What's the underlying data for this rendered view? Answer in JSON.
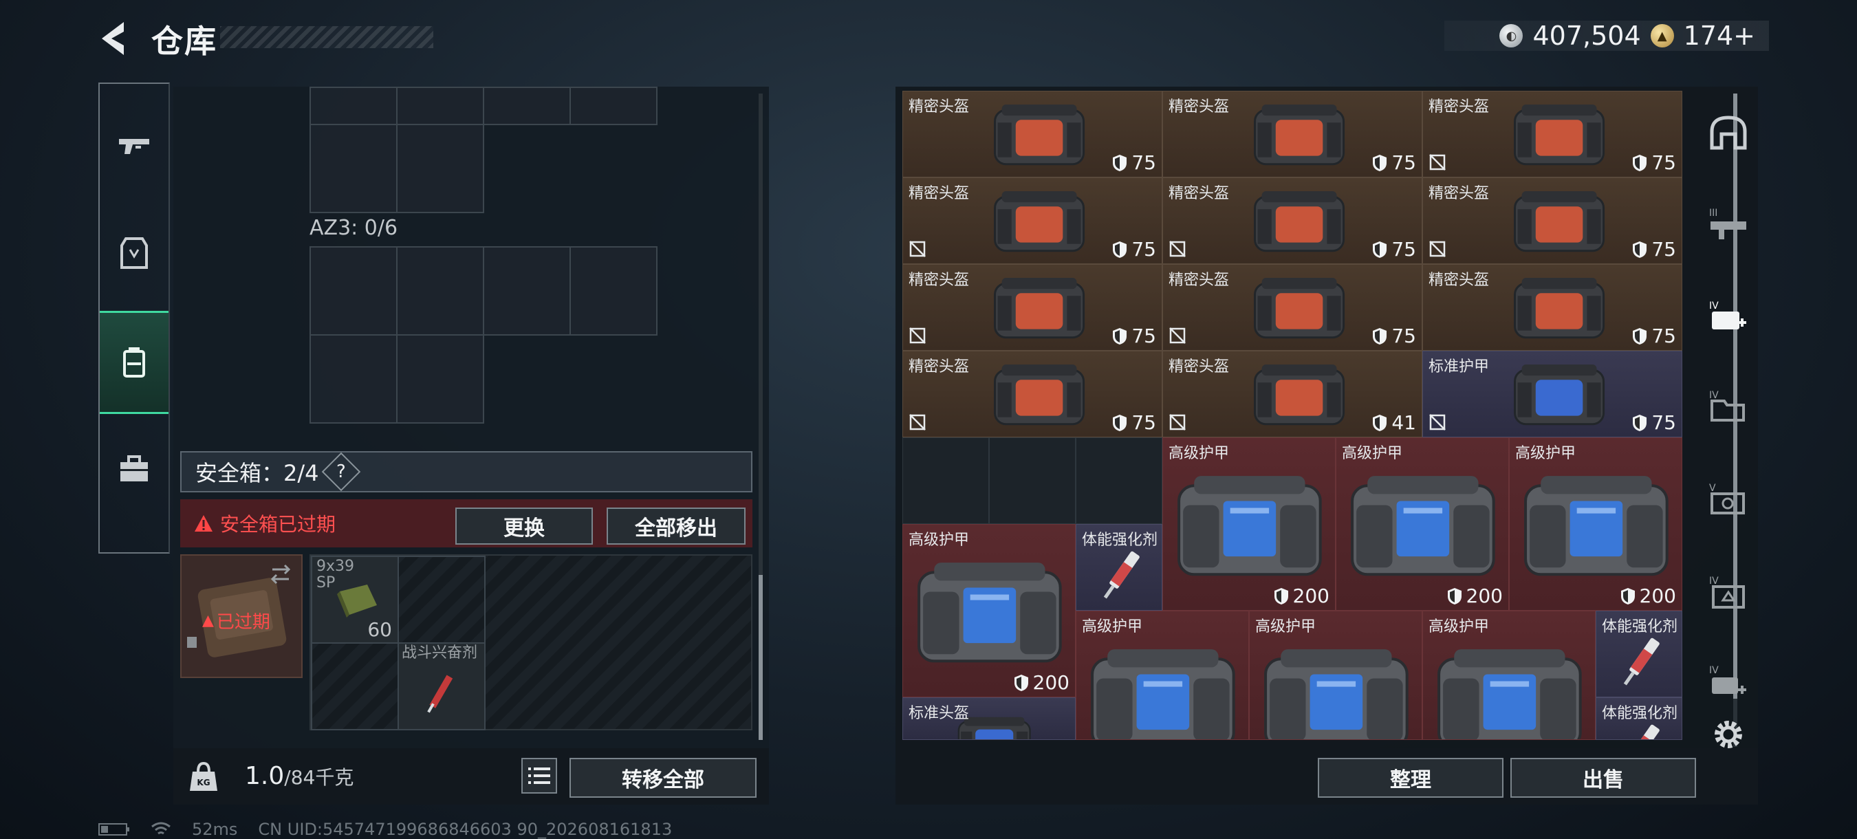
{
  "header": {
    "title": "仓库",
    "currency_silver": "407,504",
    "currency_gold": "174+"
  },
  "left": {
    "az_label": "AZ3: 0/6",
    "safebox_label": "安全箱：2/4",
    "help": "?",
    "expired_warning": "安全箱已过期",
    "replace_button": "更换",
    "move_all_out_button": "全部移出",
    "item_expired": "已过期",
    "ammo_label_line1": "9x39",
    "ammo_label_line2": "SP",
    "ammo_count": "60",
    "stim_label": "战斗兴奋剂",
    "weight_value": "1.0",
    "weight_max": "/84千克",
    "transfer_all_button": "转移全部",
    "weight_icon_label": "KG"
  },
  "right": {
    "sort_button": "整理",
    "sell_button": "出售",
    "items": [
      {
        "name": "精密头盔",
        "dur": "75",
        "kind": "helmet",
        "color": "brown",
        "noslot": false
      },
      {
        "name": "精密头盔",
        "dur": "75",
        "kind": "helmet",
        "color": "brown",
        "noslot": false
      },
      {
        "name": "精密头盔",
        "dur": "75",
        "kind": "helmet",
        "color": "brown",
        "noslot": true
      },
      {
        "name": "精密头盔",
        "dur": "75",
        "kind": "helmet",
        "color": "brown",
        "noslot": true
      },
      {
        "name": "精密头盔",
        "dur": "75",
        "kind": "helmet",
        "color": "brown",
        "noslot": true
      },
      {
        "name": "精密头盔",
        "dur": "75",
        "kind": "helmet",
        "color": "brown",
        "noslot": true
      },
      {
        "name": "精密头盔",
        "dur": "75",
        "kind": "helmet",
        "color": "brown",
        "noslot": true
      },
      {
        "name": "精密头盔",
        "dur": "75",
        "kind": "helmet",
        "color": "brown",
        "noslot": true
      },
      {
        "name": "精密头盔",
        "dur": "75",
        "kind": "helmet",
        "color": "brown",
        "noslot": false
      },
      {
        "name": "精密头盔",
        "dur": "75",
        "kind": "helmet",
        "color": "brown",
        "noslot": true
      },
      {
        "name": "精密头盔",
        "dur": "41",
        "kind": "helmet",
        "color": "brown",
        "noslot": true
      },
      {
        "name": "标准护甲",
        "dur": "75",
        "kind": "helmet-blue",
        "color": "purple",
        "noslot": true
      },
      {
        "name": "高级护甲",
        "dur": "200",
        "kind": "armor",
        "color": "red"
      },
      {
        "name": "高级护甲",
        "dur": "200",
        "kind": "armor",
        "color": "red"
      },
      {
        "name": "高级护甲",
        "dur": "200",
        "kind": "armor",
        "color": "red"
      },
      {
        "name": "高级护甲",
        "dur": "200",
        "kind": "armor",
        "color": "red"
      },
      {
        "name": "体能强化剂",
        "kind": "syringe",
        "color": "purple"
      },
      {
        "name": "高级护甲",
        "kind": "armor",
        "color": "red"
      },
      {
        "name": "高级护甲",
        "kind": "armor",
        "color": "red"
      },
      {
        "name": "高级护甲",
        "kind": "armor",
        "color": "red"
      },
      {
        "name": "体能强化剂",
        "kind": "syringe",
        "color": "purple"
      },
      {
        "name": "标准头盔",
        "kind": "helmet-blue",
        "color": "purple"
      },
      {
        "name": "体能强化剂",
        "kind": "syringe",
        "color": "purple"
      }
    ]
  },
  "status": {
    "ping": "52ms",
    "uid": "CN UID:545747199686846603 90_202608161813"
  }
}
